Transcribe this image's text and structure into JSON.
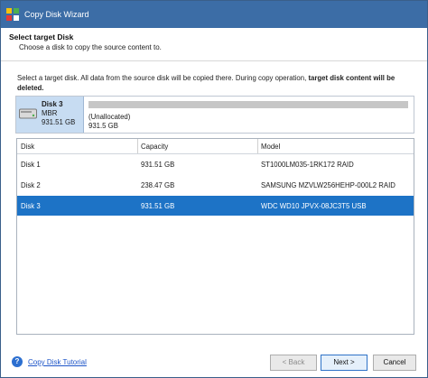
{
  "window": {
    "title": "Copy Disk Wizard"
  },
  "header": {
    "title": "Select target Disk",
    "subtitle": "Choose a disk to copy the source content to."
  },
  "notice": {
    "text_plain": "Select a target disk. All data from the source disk will be copied there. During copy operation, ",
    "text_bold": "target disk content will be deleted."
  },
  "target_disk": {
    "name": "Disk 3",
    "type": "MBR",
    "size": "931.51 GB",
    "partition_label": "(Unallocated)",
    "partition_size": "931.5 GB"
  },
  "table": {
    "headers": [
      "Disk",
      "Capacity",
      "Model"
    ],
    "rows": [
      {
        "disk": "Disk 1",
        "capacity": "931.51 GB",
        "model": "ST1000LM035-1RK172 RAID",
        "selected": false
      },
      {
        "disk": "Disk 2",
        "capacity": "238.47 GB",
        "model": "SAMSUNG MZVLW256HEHP-000L2 RAID",
        "selected": false
      },
      {
        "disk": "Disk 3",
        "capacity": "931.51 GB",
        "model": "WDC WD10 JPVX-08JC3T5 USB",
        "selected": true
      }
    ]
  },
  "footer": {
    "tutorial_link": "Copy Disk Tutorial",
    "back_label": "< Back",
    "next_label": "Next >",
    "cancel_label": "Cancel"
  }
}
